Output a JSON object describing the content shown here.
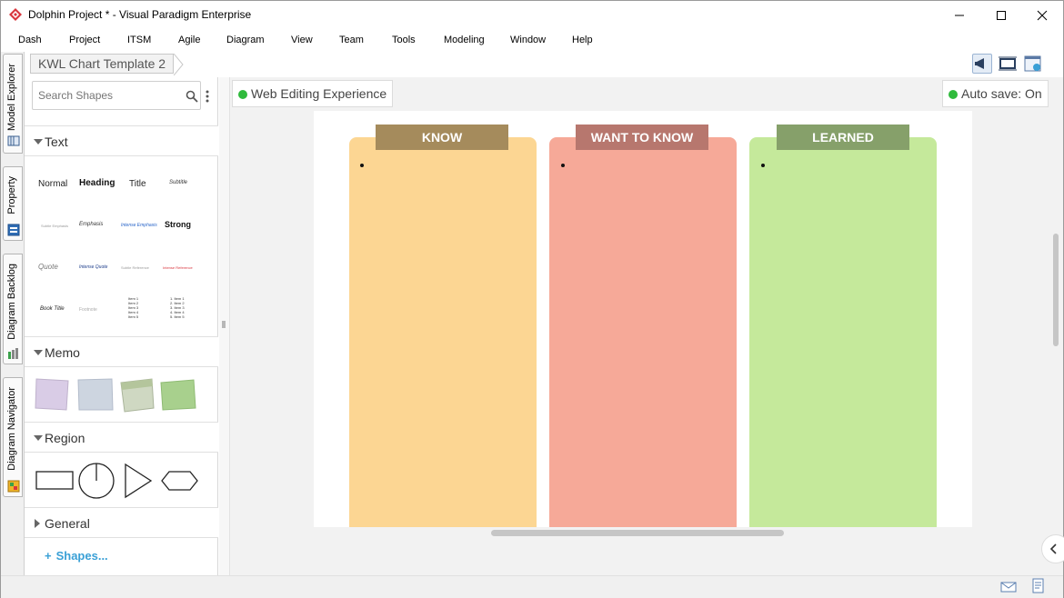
{
  "window": {
    "title": "Dolphin Project * - Visual Paradigm Enterprise",
    "app_icon": "visual-paradigm-logo",
    "controls": [
      "minimize",
      "maximize",
      "close"
    ]
  },
  "menu": [
    "Dash",
    "Project",
    "ITSM",
    "Agile",
    "Diagram",
    "View",
    "Team",
    "Tools",
    "Modeling",
    "Window",
    "Help"
  ],
  "side_tabs": [
    "Model Explorer",
    "Property",
    "Diagram Backlog",
    "Diagram Navigator"
  ],
  "breadcrumb": "KWL Chart Template 2",
  "toolbar_icons": [
    "megaphone-icon",
    "fit-diagram-icon",
    "diagram-overview-icon"
  ],
  "shapes_panel": {
    "search_placeholder": "Search Shapes",
    "sections": {
      "text": "Text",
      "memo": "Memo",
      "region": "Region",
      "general": "General"
    },
    "text_styles": {
      "normal": "Normal",
      "heading": "Heading",
      "title": "Title",
      "subtitle": "Subtitle",
      "subtle_emphasis": "Subtle Emphasis",
      "emphasis": "Emphasis",
      "intense_emphasis": "Intense Emphasis",
      "strong": "Strong",
      "quote": "Quote",
      "intense_quote": "Intense Quote",
      "subtle_reference": "Subtle Reference",
      "intense_reference": "Intense Reference",
      "book_title": "Book Title",
      "footnote": "Footnote",
      "bullet_items": [
        "Item 1",
        "Item 2",
        "Item 3",
        "Item 4",
        "Item 5"
      ],
      "numbered_items": [
        "1. Item 1",
        "2. Item 2",
        "3. Item 3",
        "4. Item 4",
        "5. Item 5"
      ]
    },
    "more_shapes": "Shapes..."
  },
  "badges": {
    "web_editing": "Web Editing Experience",
    "autosave": "Auto save: On"
  },
  "kwl": {
    "columns": [
      {
        "header": "KNOW",
        "header_color": "#a58b5c",
        "body_color": "#fcd693"
      },
      {
        "header": "WANT TO KNOW",
        "header_color": "#b7776e",
        "body_color": "#f6a998"
      },
      {
        "header": "LEARNED",
        "header_color": "#86a06a",
        "body_color": "#c5e99b"
      }
    ]
  },
  "colors": {
    "accent_green": "#2fba3c",
    "link_blue": "#3aa0d6"
  }
}
